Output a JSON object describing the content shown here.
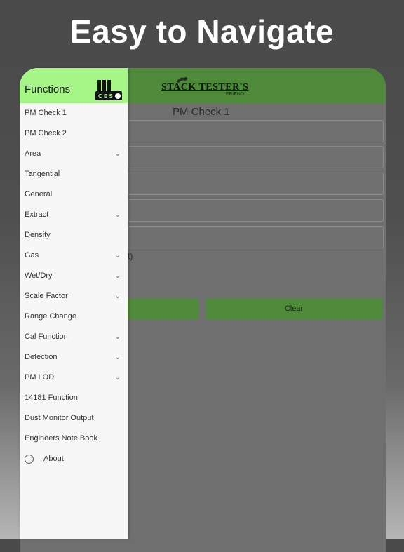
{
  "headline": "Easy to Navigate",
  "app": {
    "logo_title": "STACK TESTER'S",
    "logo_subtitle": "FRIEND",
    "page_title": "PM Check 1",
    "partial_text": "t)",
    "clear_label": "Clear"
  },
  "drawer": {
    "title": "Functions",
    "logo_text": "CES",
    "items": [
      {
        "label": "PM Check 1",
        "expandable": false
      },
      {
        "label": "PM Check 2",
        "expandable": false
      },
      {
        "label": "Area",
        "expandable": true
      },
      {
        "label": "Tangential",
        "expandable": false
      },
      {
        "label": "General",
        "expandable": false
      },
      {
        "label": "Extract",
        "expandable": true
      },
      {
        "label": "Density",
        "expandable": false
      },
      {
        "label": "Gas",
        "expandable": true
      },
      {
        "label": "Wet/Dry",
        "expandable": true
      },
      {
        "label": "Scale Factor",
        "expandable": true
      },
      {
        "label": "Range Change",
        "expandable": false
      },
      {
        "label": "Cal Function",
        "expandable": true
      },
      {
        "label": "Detection",
        "expandable": true
      },
      {
        "label": "PM LOD",
        "expandable": true
      },
      {
        "label": "14181 Function",
        "expandable": false
      },
      {
        "label": "Dust Monitor Output",
        "expandable": false
      },
      {
        "label": "Engineers Note Book",
        "expandable": false
      }
    ],
    "about_label": "About"
  },
  "colors": {
    "appbar": "#4f8a3b",
    "drawer_header": "#a6f587"
  }
}
